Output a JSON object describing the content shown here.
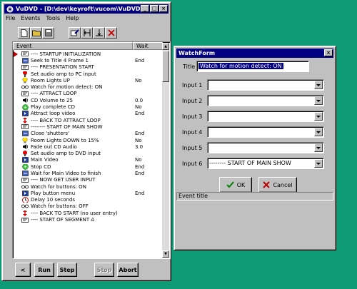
{
  "main_window": {
    "title": "VuDVD - [D:\\dev\\keyroft\\vucom\\VuDVD\\...",
    "menu": [
      "File",
      "Events",
      "Tools",
      "Help"
    ],
    "columns": {
      "event": "Event",
      "wait": "Wait"
    },
    "rows": [
      {
        "icon": "startup",
        "event": "---- STARTUP INITIALIZATION",
        "wait": ""
      },
      {
        "icon": "seek",
        "event": "Seek to Title 4 Frame 1",
        "wait": "End"
      },
      {
        "icon": "startup",
        "event": "---- PRESENTATION START",
        "wait": ""
      },
      {
        "icon": "audio",
        "event": "Set audio amp to PC input",
        "wait": ""
      },
      {
        "icon": "bulb",
        "event": "Room Lights UP",
        "wait": "No"
      },
      {
        "icon": "watch",
        "event": "Watch for motion detect: ON",
        "wait": ""
      },
      {
        "icon": "startup",
        "event": "---- ATTRACT LOOP",
        "wait": ""
      },
      {
        "icon": "volume",
        "event": "CD Volume to 25",
        "wait": "0.0"
      },
      {
        "icon": "cd",
        "event": "Play complete CD",
        "wait": "No"
      },
      {
        "icon": "video",
        "event": "Attract loop video",
        "wait": "End"
      },
      {
        "icon": "loop",
        "event": "---- BACK TO ATTRACT LOOP",
        "wait": ""
      },
      {
        "icon": "startup",
        "event": "-------- START OF MAIN SHOW",
        "wait": ""
      },
      {
        "icon": "seek",
        "event": "Close 'shutters'",
        "wait": "End"
      },
      {
        "icon": "bulb",
        "event": "Room Lights DOWN to 15%",
        "wait": "No"
      },
      {
        "icon": "volume",
        "event": "Fade out CD Audio",
        "wait": "3.0"
      },
      {
        "icon": "audio",
        "event": "Set audio amp to DVD input",
        "wait": ""
      },
      {
        "icon": "video",
        "event": "Main Video",
        "wait": "No"
      },
      {
        "icon": "cd",
        "event": "Stop CD",
        "wait": "End"
      },
      {
        "icon": "seek",
        "event": "Wait for Main Video to finish",
        "wait": "End"
      },
      {
        "icon": "startup",
        "event": "---- NOW GET USER INPUT",
        "wait": ""
      },
      {
        "icon": "watch",
        "event": "Watch for buttons: ON",
        "wait": ""
      },
      {
        "icon": "video",
        "event": "Play button menu",
        "wait": "End"
      },
      {
        "icon": "clock",
        "event": "Delay 10 seconds",
        "wait": ""
      },
      {
        "icon": "watch",
        "event": "Watch for buttons: OFF",
        "wait": ""
      },
      {
        "icon": "loop",
        "event": "---- BACK TO START (no user entry)",
        "wait": ""
      },
      {
        "icon": "startup",
        "event": "---- START OF SEGMENT A",
        "wait": ""
      }
    ],
    "buttons": {
      "back": "<",
      "run": "Run",
      "step": "Step",
      "stop": "Stop",
      "abort": "Abort"
    }
  },
  "watch_form": {
    "title": "WatchForm",
    "title_label": "Title",
    "title_value": "Watch for motion detect: ON",
    "inputs": [
      {
        "label": "Input 1",
        "value": ""
      },
      {
        "label": "Input 2",
        "value": ""
      },
      {
        "label": "Input 3",
        "value": ""
      },
      {
        "label": "Input 4",
        "value": ""
      },
      {
        "label": "Input 5",
        "value": ""
      },
      {
        "label": "Input 6",
        "value": "-------- START OF MAIN SHOW"
      }
    ],
    "ok_label": "OK",
    "cancel_label": "Cancel",
    "status": "Event title"
  },
  "colors": {
    "desktop": "#0f9a76",
    "titlebar": "#000080",
    "selection": "#000080"
  }
}
